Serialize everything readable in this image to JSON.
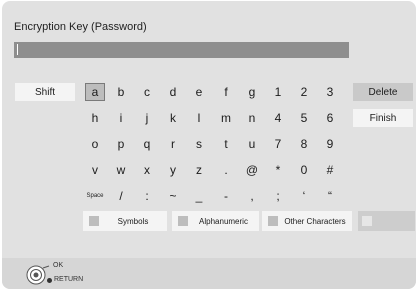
{
  "title": "Encryption Key (Password)",
  "input": {
    "value": ""
  },
  "shift_label": "Shift",
  "delete_label": "Delete",
  "finish_label": "Finish",
  "keys": [
    [
      "a",
      "b",
      "c",
      "d",
      "e",
      "f",
      "g",
      "1",
      "2",
      "3"
    ],
    [
      "h",
      "i",
      "j",
      "k",
      "l",
      "m",
      "n",
      "4",
      "5",
      "6"
    ],
    [
      "o",
      "p",
      "q",
      "r",
      "s",
      "t",
      "u",
      "7",
      "8",
      "9"
    ],
    [
      "v",
      "w",
      "x",
      "y",
      "z",
      ".",
      "@",
      "*",
      "0",
      "#"
    ],
    [
      "Space",
      "/",
      ":",
      "~",
      "_",
      "-",
      ",",
      ";",
      "‘",
      "“"
    ]
  ],
  "selected_key": "a",
  "modes": [
    {
      "label": "Symbols"
    },
    {
      "label": "Alphanumeric"
    },
    {
      "label": "Other Characters"
    }
  ],
  "footer": {
    "ok_label": "OK",
    "return_label": "RETURN"
  },
  "colors": {
    "background": "#e1e1e1",
    "input_bar": "#8e8e8e",
    "button": "#f4f4f4",
    "selected_key": "#bdbdbd"
  }
}
